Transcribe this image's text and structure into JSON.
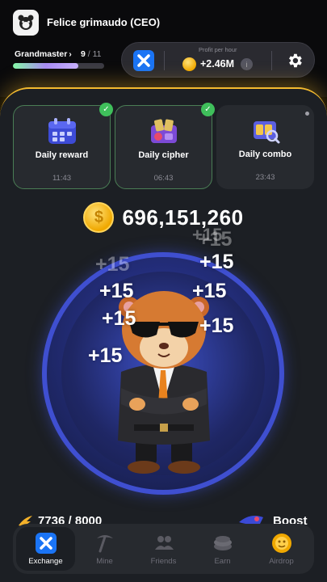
{
  "user": {
    "name": "Felice grimaudo (CEO)"
  },
  "level": {
    "rank": "Grandmaster",
    "rank_chevron": "›",
    "current": "9",
    "total": "/ 11",
    "progress": 0.72
  },
  "profit": {
    "label": "Profit per hour",
    "value": "+2.46M",
    "info": "i"
  },
  "cards": [
    {
      "title": "Daily reward",
      "time": "11:43",
      "completed": true
    },
    {
      "title": "Daily cipher",
      "time": "06:43",
      "completed": true
    },
    {
      "title": "Daily combo",
      "time": "23:43",
      "completed": false
    }
  ],
  "balance": {
    "value": "696,151,260",
    "coin_symbol": "$"
  },
  "tap_popups": [
    "+15",
    "+15",
    "+15",
    "+15",
    "+15",
    "+15",
    "+15",
    "+15",
    "+15"
  ],
  "energy": {
    "value": "7736 / 8000"
  },
  "boost": {
    "label": "Boost"
  },
  "nav": [
    {
      "label": "Exchange",
      "icon": "exchange-icon",
      "active": true
    },
    {
      "label": "Mine",
      "icon": "pickaxe-icon",
      "active": false
    },
    {
      "label": "Friends",
      "icon": "friends-icon",
      "active": false
    },
    {
      "label": "Earn",
      "icon": "coins-icon",
      "active": false
    },
    {
      "label": "Airdrop",
      "icon": "airdrop-icon",
      "active": false
    }
  ],
  "colors": {
    "accent_gold": "#f3ba2f",
    "exchange_blue": "#1a74f5",
    "check_green": "#3fbf5b",
    "panel": "#1c1f24"
  }
}
